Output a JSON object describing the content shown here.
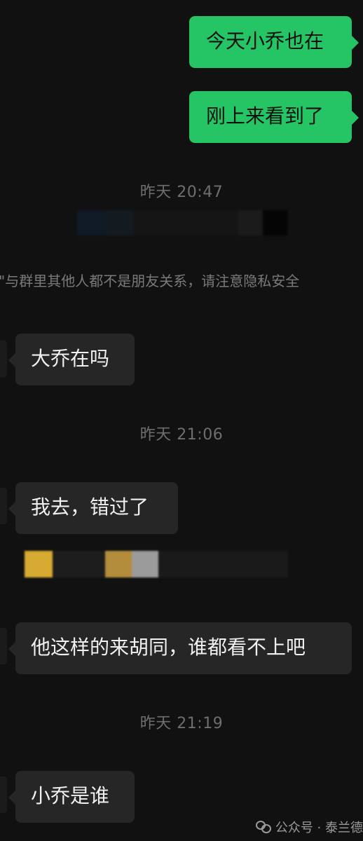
{
  "messages": [
    {
      "text": "今天小乔也在"
    },
    {
      "text": "刚上来看到了"
    },
    {
      "text": "大乔在吗"
    },
    {
      "text": "我去，错过了"
    },
    {
      "text": "他这样的来胡同，谁都看不上吧"
    },
    {
      "text": "小乔是谁"
    }
  ],
  "timestamps": [
    "昨天 20:47",
    "昨天 21:06",
    "昨天 21:19"
  ],
  "notice": "\"与群里其他人都不是朋友关系，请注意隐私安全",
  "watermark": "公众号 · 泰兰德",
  "colors": {
    "background": "#111111",
    "sent_bubble": "#25c464",
    "received_bubble": "#262626",
    "timestamp_text": "#6e6e6e"
  }
}
